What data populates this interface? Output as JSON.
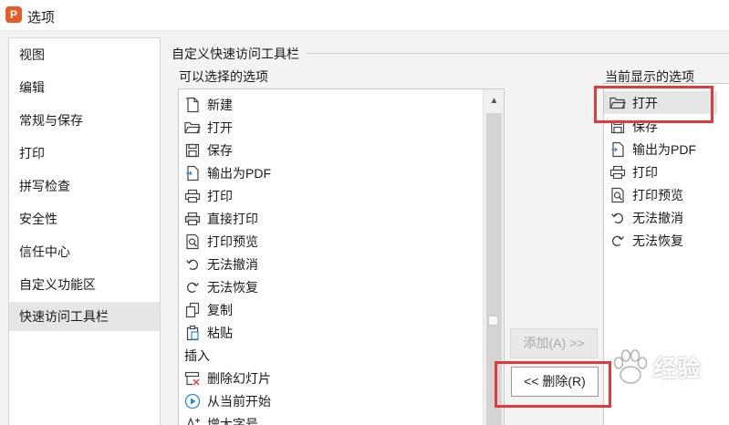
{
  "window": {
    "title": "选项",
    "logo_glyph": "P",
    "logo_color": "#e65c2a"
  },
  "sidebar": {
    "items": [
      {
        "label": "视图"
      },
      {
        "label": "编辑"
      },
      {
        "label": "常规与保存"
      },
      {
        "label": "打印"
      },
      {
        "label": "拼写检查"
      },
      {
        "label": "安全性"
      },
      {
        "label": "信任中心"
      },
      {
        "label": "自定义功能区"
      },
      {
        "label": "快速访问工具栏",
        "active": true
      }
    ]
  },
  "panel": {
    "group_title": "自定义快速访问工具栏",
    "available_label": "可以选择的选项",
    "current_label": "当前显示的选项"
  },
  "available_items": [
    {
      "label": "新建",
      "icon": "new-doc-icon"
    },
    {
      "label": "打开",
      "icon": "folder-open-icon"
    },
    {
      "label": "保存",
      "icon": "save-icon"
    },
    {
      "label": "输出为PDF",
      "icon": "export-pdf-icon"
    },
    {
      "label": "打印",
      "icon": "print-icon"
    },
    {
      "label": "直接打印",
      "icon": "direct-print-icon"
    },
    {
      "label": "打印预览",
      "icon": "print-preview-icon"
    },
    {
      "label": "无法撤消",
      "icon": "undo-icon"
    },
    {
      "label": "无法恢复",
      "icon": "redo-icon"
    },
    {
      "label": "复制",
      "icon": "copy-icon"
    },
    {
      "label": "粘贴",
      "icon": "paste-icon"
    },
    {
      "label": "插入",
      "icon": "",
      "category": true
    },
    {
      "label": "删除幻灯片",
      "icon": "delete-slide-icon"
    },
    {
      "label": "从当前开始",
      "icon": "play-from-current-icon"
    },
    {
      "label": "增大字号",
      "icon": "increase-font-icon"
    }
  ],
  "current_items": [
    {
      "label": "打开",
      "icon": "folder-open-icon",
      "selected": true
    },
    {
      "label": "保存",
      "icon": "save-icon"
    },
    {
      "label": "输出为PDF",
      "icon": "export-pdf-icon"
    },
    {
      "label": "打印",
      "icon": "print-icon"
    },
    {
      "label": "打印预览",
      "icon": "print-preview-icon"
    },
    {
      "label": "无法撤消",
      "icon": "undo-icon"
    },
    {
      "label": "无法恢复",
      "icon": "redo-icon"
    }
  ],
  "buttons": {
    "add": "添加(A) >>",
    "delete": "<< 删除(R)"
  },
  "scrollbar": {
    "up_glyph": "▲"
  },
  "watermark": {
    "text": "经验"
  },
  "colors": {
    "highlight": "#e03a3a",
    "active_item": "#e6e6e6",
    "background": "#f3f3f3"
  }
}
